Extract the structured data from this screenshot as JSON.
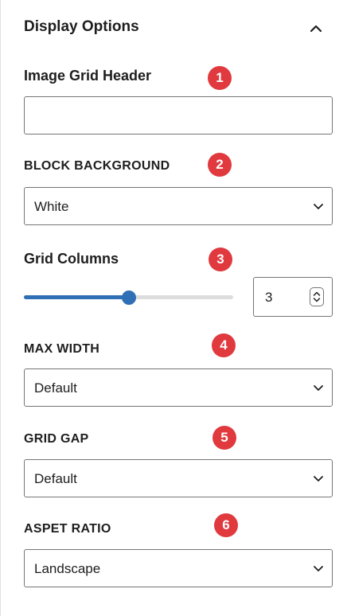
{
  "panel": {
    "title": "Display Options",
    "collapse_icon": "chevron-up-icon"
  },
  "fields": {
    "header": {
      "label": "Image Grid Header",
      "value": "",
      "badge": "1"
    },
    "background": {
      "label": "BLOCK BACKGROUND",
      "value": "White",
      "badge": "2"
    },
    "columns": {
      "label": "Grid Columns",
      "value": "3",
      "slider_fraction": 0.5,
      "badge": "3"
    },
    "max_width": {
      "label": "MAX WIDTH",
      "value": "Default",
      "badge": "4"
    },
    "grid_gap": {
      "label": "GRID GAP",
      "value": "Default",
      "badge": "5"
    },
    "aspect_ratio": {
      "label": "ASPET RATIO",
      "value": "Landscape",
      "badge": "6"
    }
  },
  "colors": {
    "badge": "#e0393e",
    "accent": "#2f6fb5",
    "border": "#757575"
  }
}
